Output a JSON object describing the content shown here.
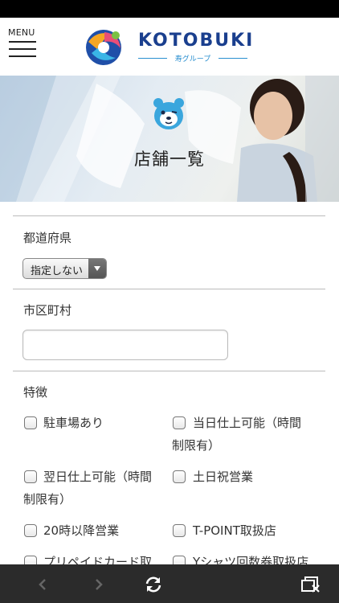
{
  "header": {
    "menu_label": "MENU",
    "logo_text": "KOTOBUKI",
    "logo_sub": "寿グループ"
  },
  "hero": {
    "title": "店舗一覧"
  },
  "form": {
    "prefecture": {
      "label": "都道府県",
      "selected": "指定しない"
    },
    "city": {
      "label": "市区町村",
      "value": ""
    },
    "features": {
      "label": "特徴",
      "items": [
        {
          "line1": "駐車場あり",
          "line2": "",
          "checked": false
        },
        {
          "line1": "当日仕上可能（時間",
          "line2": "制限有）",
          "checked": false
        },
        {
          "line1": "翌日仕上可能（時間",
          "line2": "制限有）",
          "checked": false
        },
        {
          "line1": "土日祝営業",
          "line2": "",
          "checked": false
        },
        {
          "line1": "20時以降営業",
          "line2": "",
          "checked": false
        },
        {
          "line1": "T-POINT取扱店",
          "line2": "",
          "checked": false
        },
        {
          "line1": "プリペイドカード取",
          "line2": "",
          "checked": false
        },
        {
          "line1": "Yシャツ回数券取扱店",
          "line2": "",
          "checked": false
        }
      ]
    }
  },
  "toolbar": {
    "icons": [
      "back-arrow-icon",
      "forward-arrow-icon",
      "reload-icon",
      "close-tabs-icon"
    ]
  }
}
